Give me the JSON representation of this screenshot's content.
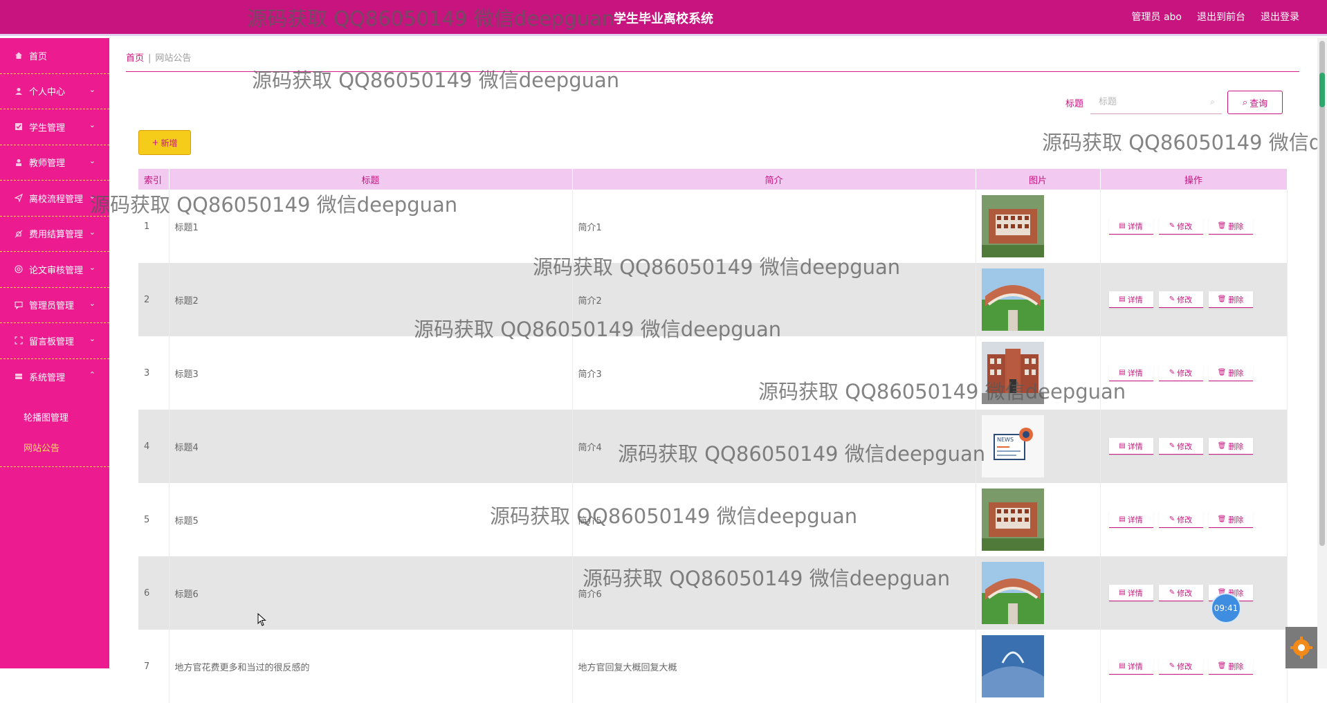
{
  "header": {
    "app_title": "学生毕业离校系统",
    "links": [
      "管理员 abo",
      "退出到前台",
      "退出登录"
    ]
  },
  "sidebar": {
    "items": [
      {
        "label": "首页",
        "icon": "home-icon"
      },
      {
        "label": "个人中心",
        "icon": "user-icon"
      },
      {
        "label": "学生管理",
        "icon": "checkbox-icon"
      },
      {
        "label": "教师管理",
        "icon": "person-icon"
      },
      {
        "label": "离校流程管理",
        "icon": "send-icon"
      },
      {
        "label": "费用结算管理",
        "icon": "bell-off-icon"
      },
      {
        "label": "论文审核管理",
        "icon": "target-icon"
      },
      {
        "label": "管理员管理",
        "icon": "chat-icon"
      },
      {
        "label": "留言板管理",
        "icon": "frame-icon"
      },
      {
        "label": "系统管理",
        "icon": "server-icon"
      }
    ],
    "submenu": [
      "轮播图管理",
      "网站公告"
    ]
  },
  "breadcrumb": {
    "home": "首页",
    "separator": "|",
    "current": "网站公告"
  },
  "search": {
    "label": "标题",
    "placeholder": "标题",
    "button": "查询"
  },
  "add_button": "新增",
  "table": {
    "headers": [
      "索引",
      "标题",
      "简介",
      "图片",
      "操作"
    ],
    "rows": [
      {
        "index": "1",
        "title": "标题1",
        "intro": "简介1",
        "image": "building-aerial"
      },
      {
        "index": "2",
        "title": "标题2",
        "intro": "简介2",
        "image": "campus-curve"
      },
      {
        "index": "3",
        "title": "标题3",
        "intro": "简介3",
        "image": "school-entrance"
      },
      {
        "index": "4",
        "title": "标题4",
        "intro": "简介4",
        "image": "news-icon"
      },
      {
        "index": "5",
        "title": "标题5",
        "intro": "简介5",
        "image": "building-aerial"
      },
      {
        "index": "6",
        "title": "标题6",
        "intro": "简介6",
        "image": "campus-curve"
      },
      {
        "index": "7",
        "title": "地方官花费更多和当过的很反感的",
        "intro": "地方官回复大概回复大概",
        "image": "sky-clouds"
      }
    ],
    "actions": [
      "详情",
      "修改",
      "删除"
    ]
  },
  "watermark": "源码获取 QQ86050149 微信deepguan",
  "clock": "09:41",
  "colors": {
    "topbar": "#c8147f",
    "sidebar": "#ec1b8f",
    "accent": "#c8147f",
    "table_header": "#f2c9f0",
    "add_button": "#f6cc1a",
    "active_submenu": "#ffe35c"
  }
}
